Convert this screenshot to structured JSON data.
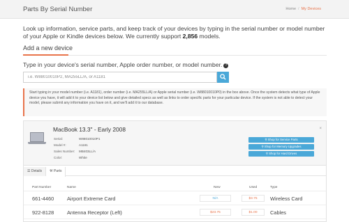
{
  "header": {
    "title": "Parts By Serial Number",
    "breadcrumb": {
      "home": "Home",
      "separator": "/",
      "current": "My Devices"
    }
  },
  "intro": {
    "text_before": "Look up information, service parts, and keep track of your devices by typing in the serial number or model number of your Apple or Kindle devices below. We currently support ",
    "count": "2,856",
    "text_after": " models."
  },
  "section": {
    "title": "Add a new device"
  },
  "search": {
    "prompt": "Type in your device's serial number, Apple order number, or model number.",
    "help_icon": "?",
    "placeholder": "i.e. W88010010P2, MA255LL/A, or A1181",
    "value": "",
    "button_icon": "search-icon"
  },
  "info": {
    "text": "Start typing in your model number (i.e. A1181), order number (i.e. MA255LL/A) or Apple serial number (i.e. W88010010P0) in the box above. Once the system detects what type of Apple device you have, it will add it to your device list below and give detailed specs as well as links to order specific parts for your particular device. If the system is not able to detect your model, please submit any information you have on it, and we'll add it to our database."
  },
  "device": {
    "name": "MacBook 13.3\" - Early 2008",
    "specs": [
      {
        "label": "Serial:",
        "value": "W88010010P1"
      },
      {
        "label": "Model #:",
        "value": "A1181"
      },
      {
        "label": "Sales Number:",
        "value": "MB403LL/A"
      },
      {
        "label": "Color:",
        "value": "White"
      }
    ],
    "shop_buttons": [
      "Shop for Service Parts",
      "Shop for Memory Upgrades",
      "Shop for Hard Drives"
    ],
    "close_label": "×",
    "tabs": {
      "details": "Details",
      "parts": "Parts"
    }
  },
  "parts_table": {
    "headers": {
      "part_number": "Part Number",
      "name": "Name",
      "new": "New",
      "used": "Used",
      "type": "Type"
    },
    "rows": [
      {
        "part_number": "661-4460",
        "name": "Airport Extreme Card",
        "new": "N/A",
        "used": "$3.75",
        "type": "Wireless Card"
      },
      {
        "part_number": "922-8128",
        "name": "Antenna Receptor (Left)",
        "new": "$23.75",
        "used": "$1.00",
        "type": "Cables"
      },
      {
        "part_number": "",
        "name": "",
        "new": "",
        "used": "",
        "type": ""
      }
    ]
  },
  "colors": {
    "accent": "#e8734a",
    "primary": "#4aa8d8"
  }
}
